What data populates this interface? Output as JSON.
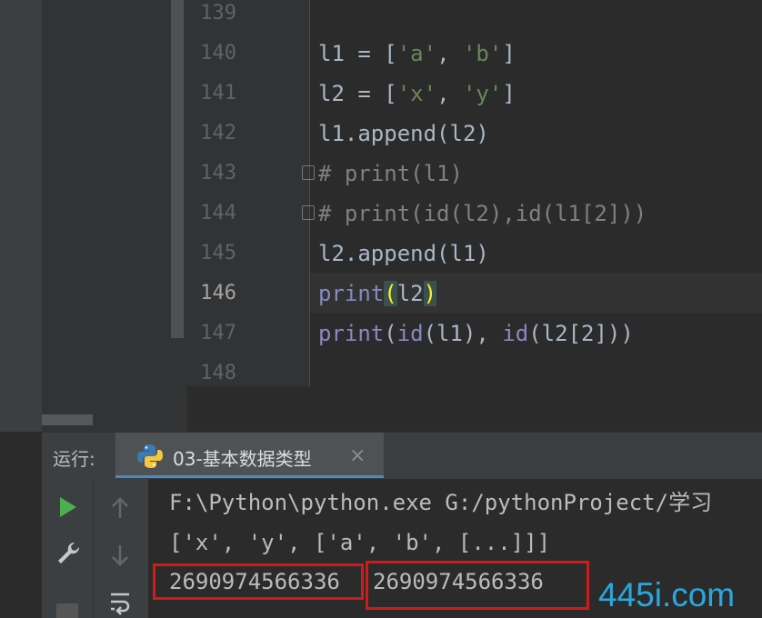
{
  "editor": {
    "line_numbers": [
      "139",
      "140",
      "141",
      "142",
      "143",
      "144",
      "145",
      "146",
      "147",
      "148"
    ],
    "lines": {
      "l140": {
        "pre": "l1 = [",
        "s1": "'a'",
        "mid": ", ",
        "s2": "'b'",
        "post": "]"
      },
      "l141": {
        "pre": "l2 = [",
        "s1": "'x'",
        "mid": ", ",
        "s2": "'y'",
        "post": "]"
      },
      "l142": "l1.append(l2)",
      "l143": "# print(l1)",
      "l144": "# print(id(l2),id(l1[2]))",
      "l145": "l2.append(l1)",
      "l146": {
        "fn": "print",
        "open": "(",
        "arg": "l2",
        "close": ")"
      },
      "l147": {
        "fn1": "print",
        "p1": "(",
        "fn2": "id",
        "a1": "(l1), ",
        "fn3": "id",
        "a2": "(l2[2]))"
      }
    }
  },
  "run_panel": {
    "label": "运行:",
    "tab_label": "03-基本数据类型",
    "close_glyph": "×"
  },
  "console": {
    "line1": "F:\\Python\\python.exe G:/pythonProject/学习",
    "line2": "['x', 'y', ['a', 'b', [...]]]",
    "id_a": "2690974566336",
    "id_b": "2690974566336"
  },
  "watermark": "445i.com",
  "colors": {
    "background": "#2b2b2b",
    "string": "#6a8759",
    "builtin": "#8888c6",
    "comment": "#808080",
    "highlight_box": "#d11a1a",
    "run_green": "#4caf50",
    "watermark": "#29a8e0"
  },
  "icons": [
    "play-icon",
    "wrench-icon",
    "arrow-up-icon",
    "arrow-down-icon",
    "soft-wrap-icon",
    "stop-icon",
    "python-icon",
    "close-icon",
    "fold-icon"
  ]
}
